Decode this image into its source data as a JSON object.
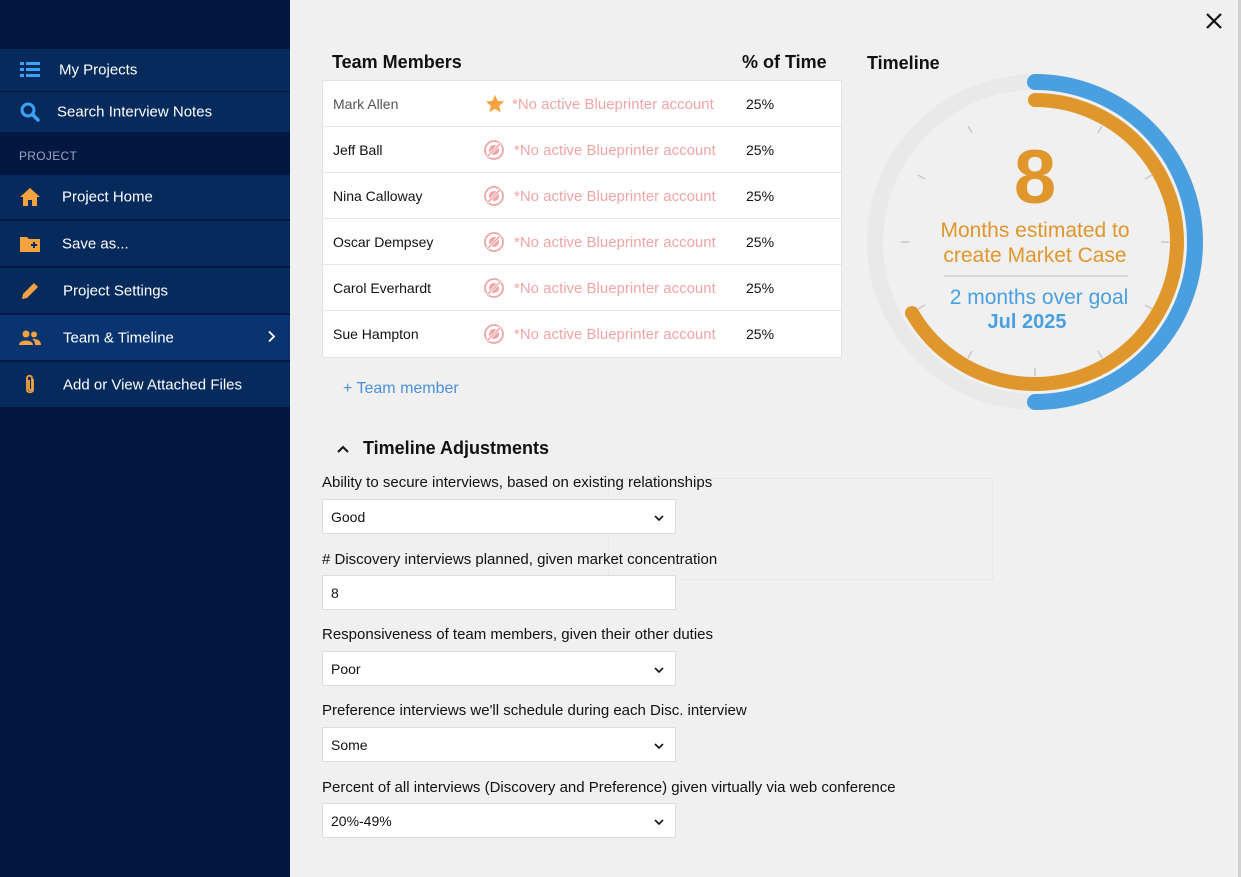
{
  "sidebar": {
    "items": [
      {
        "label": "My Projects",
        "icon": "list-icon"
      },
      {
        "label": "Search Interview Notes",
        "icon": "search-icon"
      },
      {
        "label": "Project Home",
        "icon": "home-icon"
      },
      {
        "label": "Save as...",
        "icon": "folder-plus-icon"
      },
      {
        "label": "Project Settings",
        "icon": "pencil-icon"
      },
      {
        "label": "Team & Timeline",
        "icon": "people-icon"
      },
      {
        "label": "Add or View Attached Files",
        "icon": "paperclip-icon"
      }
    ],
    "section_label": "PROJECT",
    "active_item": "Team & Timeline"
  },
  "team": {
    "header_members": "Team Members",
    "header_time": "% of Time",
    "members": [
      {
        "name": "Mark Allen",
        "account": "*No active Blueprinter account",
        "pct": "25%",
        "badge": "star-icon"
      },
      {
        "name": "Jeff Ball",
        "account": "*No active Blueprinter account",
        "pct": "25%",
        "badge": "no-account-icon"
      },
      {
        "name": "Nina Calloway",
        "account": "*No active Blueprinter account",
        "pct": "25%",
        "badge": "no-account-icon"
      },
      {
        "name": "Oscar Dempsey",
        "account": "*No active Blueprinter account",
        "pct": "25%",
        "badge": "no-account-icon"
      },
      {
        "name": "Carol Everhardt",
        "account": "*No active Blueprinter account",
        "pct": "25%",
        "badge": "no-account-icon"
      },
      {
        "name": "Sue Hampton",
        "account": "*No active Blueprinter account",
        "pct": "25%",
        "badge": "no-account-icon"
      }
    ],
    "add_member": "+ Team member"
  },
  "timeline": {
    "title": "Timeline",
    "months": "8",
    "line1": "Months estimated to",
    "line2": "create Market Case",
    "over_goal": "2 months over goal",
    "date": "Jul 2025"
  },
  "adjustments": {
    "title": "Timeline Adjustments",
    "questions": [
      {
        "label": "Ability to secure interviews, based on existing relationships",
        "value": "Good",
        "type": "select"
      },
      {
        "label": "# Discovery interviews planned, given market concentration",
        "value": "8",
        "type": "input"
      },
      {
        "label": "Responsiveness of team members, given their other duties",
        "value": "Poor",
        "type": "select"
      },
      {
        "label": "Preference interviews we'll schedule during each Disc. interview",
        "value": "Some",
        "type": "select"
      },
      {
        "label": "Percent of all interviews (Discovery and Preference) given virtually via web conference",
        "value": "20%-49%",
        "type": "select"
      }
    ]
  },
  "colors": {
    "sidebar_bg": "#031840",
    "nav_bg": "#062a5c",
    "accent_orange": "#df962c",
    "accent_blue": "#4a9fe0",
    "warning_pink": "#f0a5a5"
  }
}
